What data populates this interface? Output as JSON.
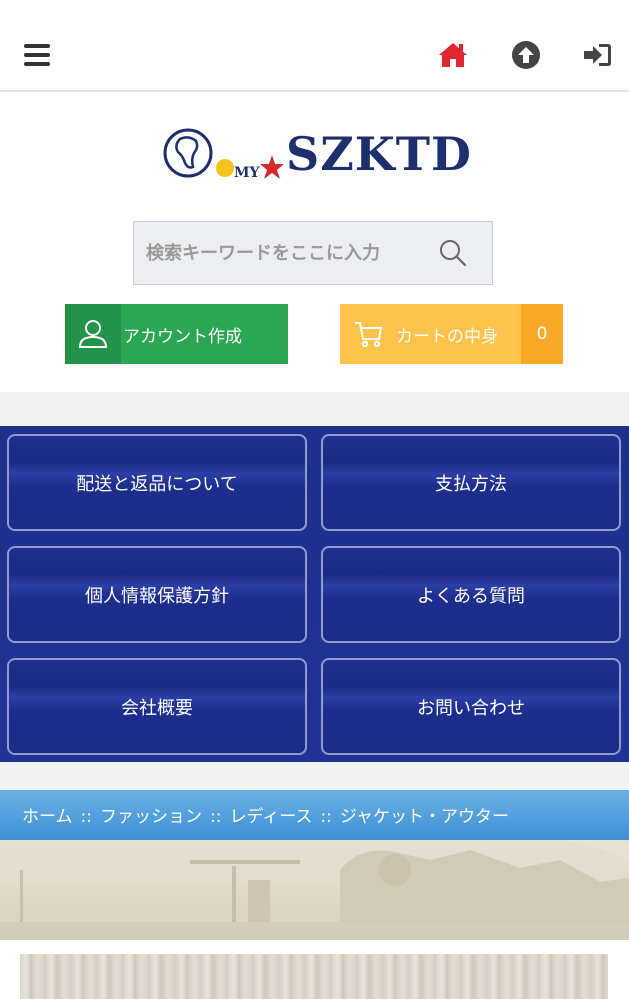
{
  "topbar": {
    "menu_icon": "hamburger-menu-icon",
    "home_icon": "home-icon",
    "home_color": "#e0262e",
    "scroll_up_icon": "arrow-up-circle-icon",
    "login_icon": "sign-in-icon"
  },
  "logo": {
    "text": "SZKTD",
    "prefix": "MY",
    "star_color": "#d32b2f",
    "dot_color": "#f9c21b",
    "brand_color": "#1e2f6e"
  },
  "search": {
    "placeholder": "検索キーワードをここに入力",
    "value": "",
    "button_icon": "search-icon"
  },
  "account_button": {
    "label": "アカウント作成",
    "icon": "user-icon",
    "color": "#2aa753"
  },
  "cart_button": {
    "label": "カートの中身",
    "count": "0",
    "icon": "cart-icon",
    "color": "#fec34a"
  },
  "menu": {
    "items": [
      {
        "label": "配送と返品について"
      },
      {
        "label": "支払方法"
      },
      {
        "label": "個人情報保護方針"
      },
      {
        "label": "よくある質問"
      },
      {
        "label": "会社概要"
      },
      {
        "label": "お問い合わせ"
      }
    ],
    "bg_color": "#1e2f8c"
  },
  "breadcrumb": {
    "items": [
      "ホーム",
      "ファッション",
      "レディース",
      "ジャケット・アウター"
    ],
    "separator": "::"
  }
}
